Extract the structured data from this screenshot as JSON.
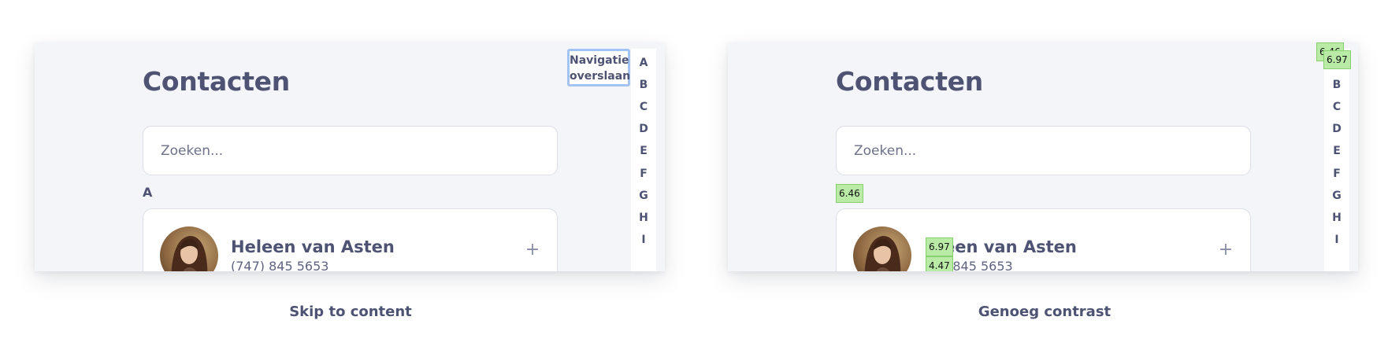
{
  "panels": [
    {
      "title": "Contacten",
      "search": {
        "placeholder": "Zoeken..."
      },
      "section_letter": "A",
      "contact": {
        "name": "Heleen van Asten",
        "phone": "(747) 845 5653",
        "add_icon": "plus-icon"
      },
      "skip_link": "Navigatie overslaan",
      "caption": "Skip to content"
    },
    {
      "title": "Contacten",
      "search": {
        "placeholder": "Zoeken..."
      },
      "contact": {
        "name": "een van Asten",
        "phone": ") 845 5653",
        "add_icon": "plus-icon"
      },
      "contrast_badges": {
        "section": "6.46",
        "top_back": "6.46",
        "top_front": "6.97",
        "name": "6.97",
        "phone": "4.47"
      },
      "caption": "Genoeg contrast"
    }
  ],
  "alphabet_left": [
    "A",
    "B",
    "C",
    "D",
    "E",
    "F",
    "G",
    "H",
    "I"
  ],
  "alphabet_right": [
    "B",
    "C",
    "D",
    "E",
    "F",
    "G",
    "H",
    "I"
  ],
  "colors": {
    "text": "#4e5373",
    "panel_background": "#f4f5f9",
    "focus_outline": "#a3c4f3",
    "badge_fill": "#b9eba7"
  }
}
